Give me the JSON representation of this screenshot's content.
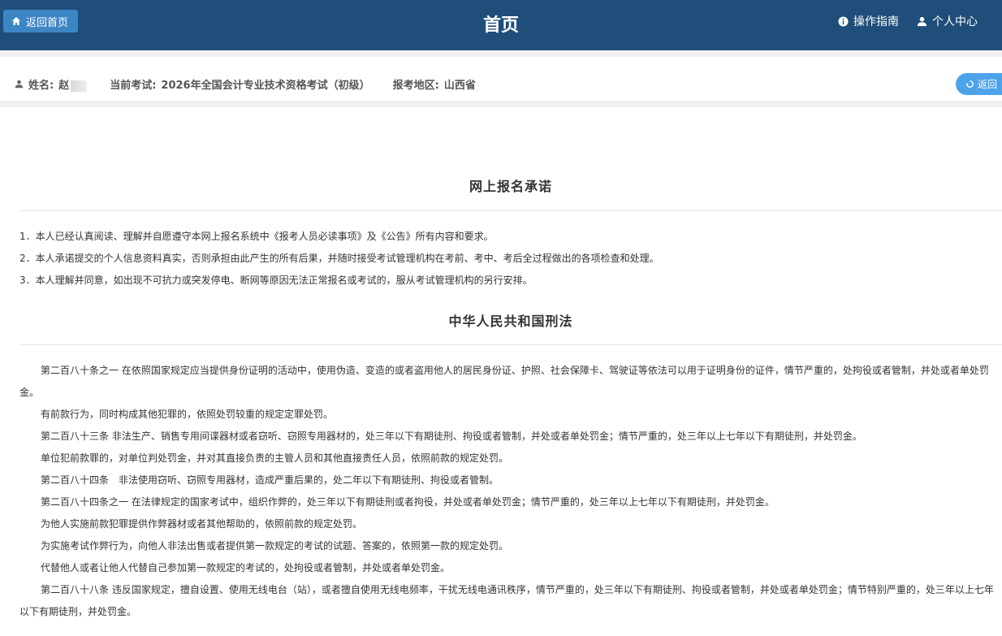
{
  "header": {
    "home_button": "返回首页",
    "title": "首页",
    "guide_link": "操作指南",
    "profile_link": "个人中心"
  },
  "info": {
    "name_label": "姓名:",
    "name_value": "赵",
    "exam_label": "当前考试:",
    "exam_value": "2026年全国会计专业技术资格考试（初级）",
    "region_label": "报考地区:",
    "region_value": "山西省",
    "back_button": "返回"
  },
  "pledge": {
    "title": "网上报名承诺",
    "items": [
      "1．本人已经认真阅读、理解并自愿遵守本网上报名系统中《报考人员必读事项》及《公告》所有内容和要求。",
      "2．本人承诺提交的个人信息资料真实，否则承担由此产生的所有后果，并随时接受考试管理机构在考前、考中、考后全过程做出的各项检查和处理。",
      "3．本人理解并同意，如出现不可抗力或突发停电、断网等原因无法正常报名或考试的，服从考试管理机构的另行安排。"
    ]
  },
  "law": {
    "title": "中华人民共和国刑法",
    "paragraphs": [
      "第二百八十条之一 在依照国家规定应当提供身份证明的活动中，使用伪造、变造的或者盗用他人的居民身份证、护照、社会保障卡、驾驶证等依法可以用于证明身份的证件，情节严重的，处拘役或者管制，并处或者单处罚金。",
      "有前款行为，同时构成其他犯罪的，依照处罚较重的规定定罪处罚。",
      "第二百八十三条 非法生产、销售专用间谍器材或者窃听、窃照专用器材的，处三年以下有期徒刑、拘役或者管制，并处或者单处罚金；情节严重的，处三年以上七年以下有期徒刑，并处罚金。",
      "单位犯前款罪的，对单位判处罚金，并对其直接负责的主管人员和其他直接责任人员，依照前款的规定处罚。",
      "第二百八十四条　非法使用窃听、窃照专用器材，造成严重后果的，处二年以下有期徒刑、拘役或者管制。",
      "第二百八十四条之一 在法律规定的国家考试中，组织作弊的，处三年以下有期徒刑或者拘役，并处或者单处罚金；情节严重的，处三年以上七年以下有期徒刑，并处罚金。",
      "为他人实施前款犯罪提供作弊器材或者其他帮助的，依照前款的规定处罚。",
      "为实施考试作弊行为，向他人非法出售或者提供第一款规定的考试的试题、答案的，依照第一款的规定处罚。",
      "代替他人或者让他人代替自己参加第一款规定的考试的，处拘役或者管制，并处或者单处罚金。",
      "第二百八十八条 违反国家规定，擅自设置、使用无线电台（站），或者擅自使用无线电频率，干扰无线电通讯秩序，情节严重的，处三年以下有期徒刑、拘役或者管制，并处或者单处罚金；情节特别严重的，处三年以上七年以下有期徒刑，并处罚金。"
    ]
  }
}
